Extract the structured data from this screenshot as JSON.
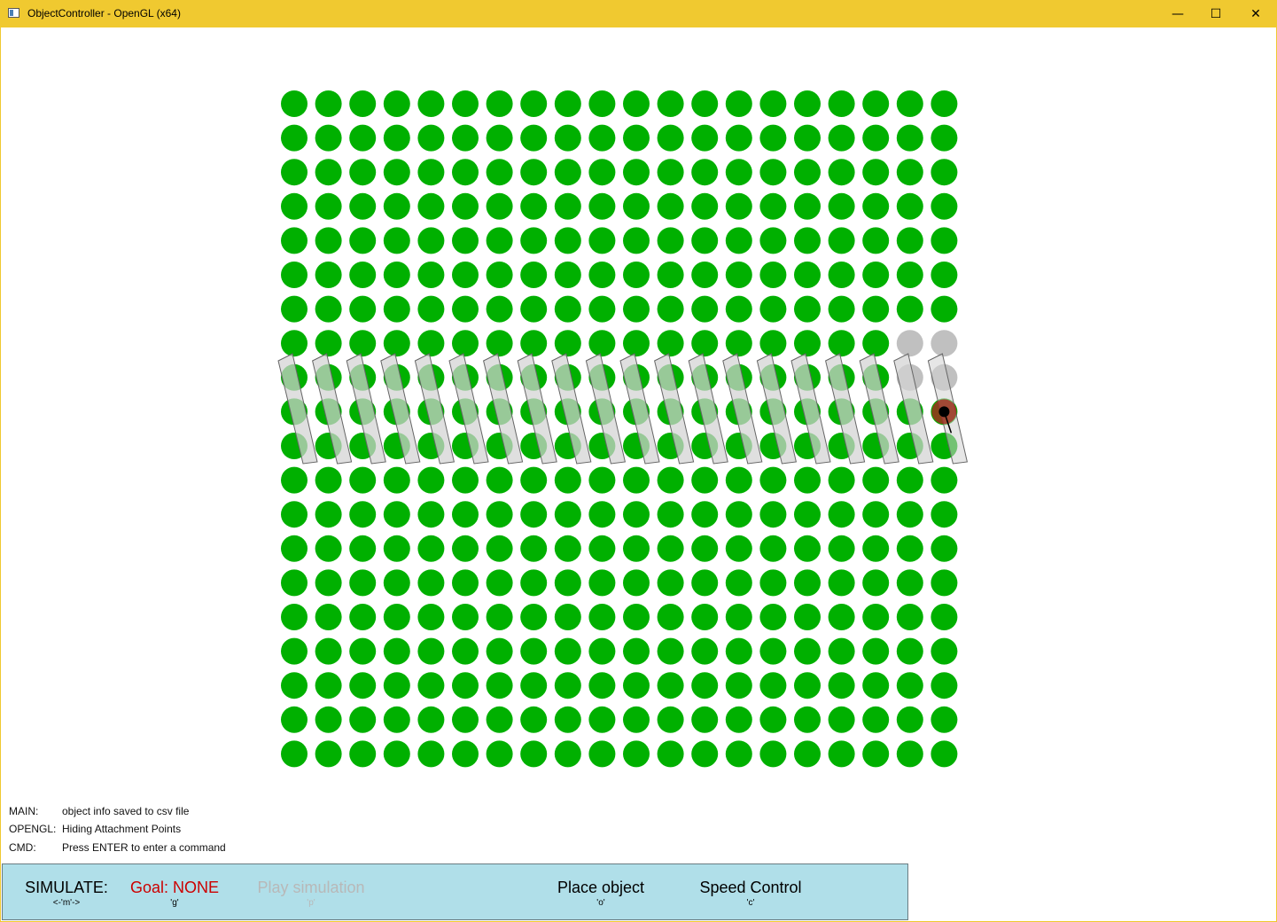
{
  "window": {
    "title": "ObjectController - OpenGL (x64)",
    "controls": {
      "minimize": "—",
      "maximize": "☐",
      "close": "✕"
    }
  },
  "colors": {
    "titlebar": "#f0c930",
    "dot_active": "#00b000",
    "dot_inactive": "#c0c0c0",
    "object_fill": "#d2d2d2",
    "panel_bg": "#b0dfe9",
    "goal_text": "#cc0000",
    "disabled_text": "#b8b8b8",
    "target_ring": "#b02020"
  },
  "grid": {
    "rows": 20,
    "cols": 20,
    "inactive_cells": [
      [
        7,
        18
      ],
      [
        7,
        19
      ],
      [
        8,
        18
      ],
      [
        8,
        19
      ]
    ]
  },
  "log": [
    {
      "tag": "MAIN:",
      "message": "object info saved to csv file"
    },
    {
      "tag": "OPENGL:",
      "message": "Hiding Attachment Points"
    },
    {
      "tag": "CMD:",
      "message": "Press ENTER to enter a command"
    }
  ],
  "panel": {
    "simulate": {
      "label": "SIMULATE:",
      "key": "<-'m'->"
    },
    "goal": {
      "label": "Goal: NONE",
      "key": "'g'"
    },
    "play": {
      "label": "Play simulation",
      "key": "'p'",
      "enabled": false
    },
    "place": {
      "label": "Place object",
      "key": "'o'"
    },
    "speed": {
      "label": "Speed Control",
      "key": "'c'"
    }
  }
}
